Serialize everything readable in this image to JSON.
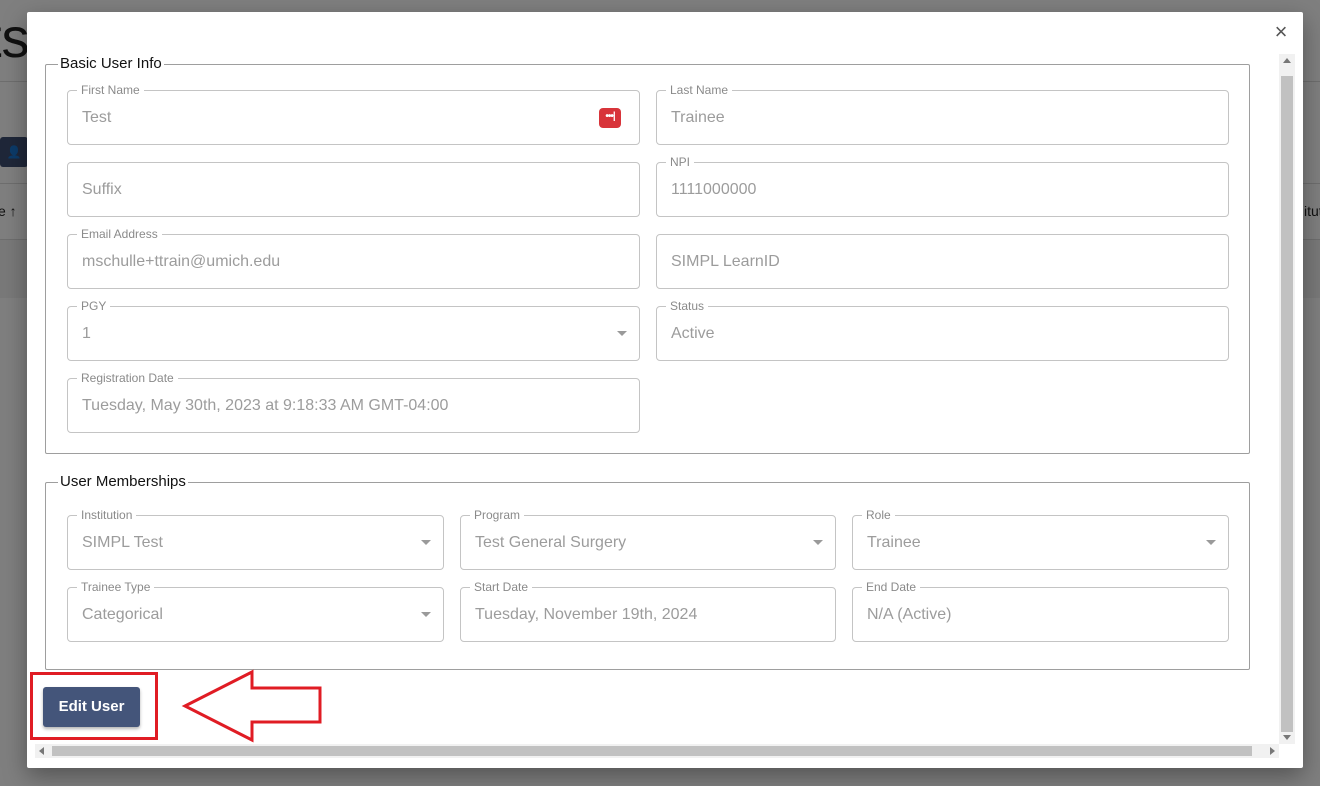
{
  "background": {
    "title_fragment": "ts",
    "left_column_fragment": "e",
    "right_column_fragment": "itut"
  },
  "modal": {
    "close_label": "×",
    "basic_info": {
      "legend": "Basic User Info",
      "first_name": {
        "label": "First Name",
        "value": "Test"
      },
      "last_name": {
        "label": "Last Name",
        "value": "Trainee"
      },
      "suffix": {
        "placeholder": "Suffix"
      },
      "npi": {
        "label": "NPI",
        "value": "1111000000"
      },
      "email": {
        "label": "Email Address",
        "value": "mschulle+ttrain@umich.edu"
      },
      "learn_id": {
        "placeholder": "SIMPL LearnID"
      },
      "pgy": {
        "label": "PGY",
        "value": "1"
      },
      "status": {
        "label": "Status",
        "value": "Active"
      },
      "registration_date": {
        "label": "Registration Date",
        "value": "Tuesday, May 30th, 2023 at 9:18:33 AM GMT-04:00"
      }
    },
    "memberships": {
      "legend": "User Memberships",
      "institution": {
        "label": "Institution",
        "value": "SIMPL Test"
      },
      "program": {
        "label": "Program",
        "value": "Test General Surgery"
      },
      "role": {
        "label": "Role",
        "value": "Trainee"
      },
      "trainee_type": {
        "label": "Trainee Type",
        "value": "Categorical"
      },
      "start_date": {
        "label": "Start Date",
        "value": "Tuesday, November 19th, 2024"
      },
      "end_date": {
        "label": "End Date",
        "value": "N/A (Active)"
      }
    },
    "edit_button_label": "Edit User"
  },
  "colors": {
    "button": "#44557a",
    "annotation": "#e01c24",
    "password_manager_icon": "#d8343a"
  }
}
